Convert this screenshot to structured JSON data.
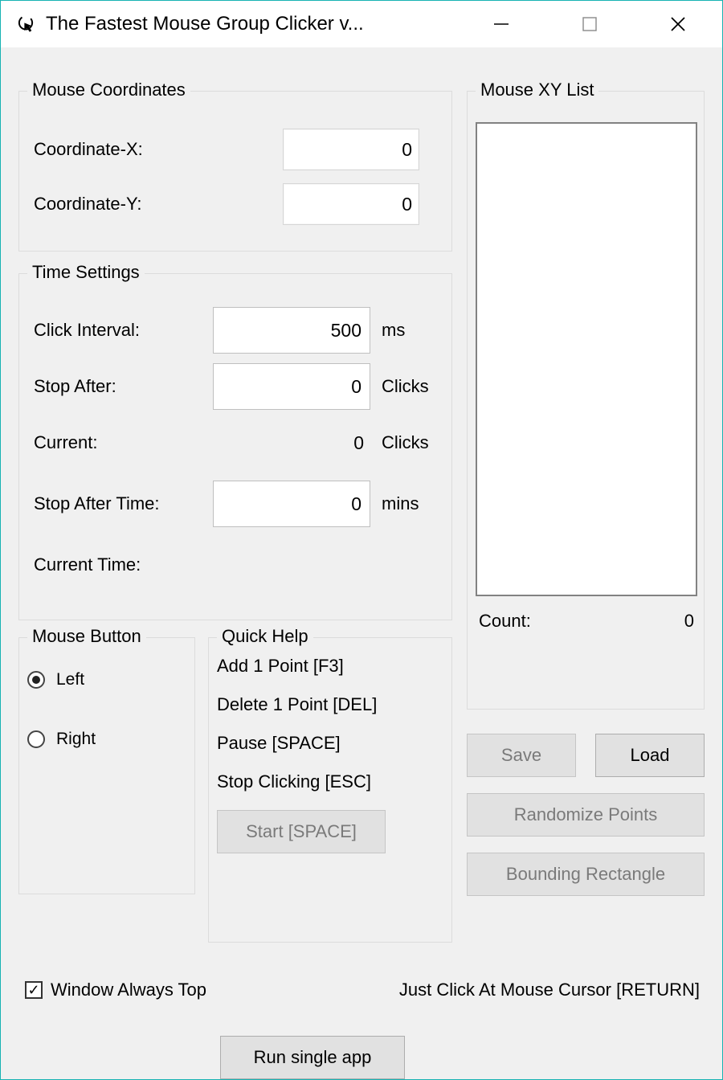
{
  "window": {
    "title": "The Fastest Mouse Group Clicker v..."
  },
  "coords": {
    "legend": "Mouse Coordinates",
    "x_label": "Coordinate-X:",
    "y_label": "Coordinate-Y:",
    "x_value": "0",
    "y_value": "0"
  },
  "time": {
    "legend": "Time Settings",
    "click_interval_label": "Click Interval:",
    "click_interval_value": "500",
    "click_interval_unit": "ms",
    "stop_after_label": "Stop After:",
    "stop_after_value": "0",
    "stop_after_unit": "Clicks",
    "current_label": "Current:",
    "current_value": "0",
    "current_unit": "Clicks",
    "stop_after_time_label": "Stop After Time:",
    "stop_after_time_value": "0",
    "stop_after_time_unit": "mins",
    "current_time_label": "Current Time:",
    "current_time_value": ""
  },
  "mouse_button": {
    "legend": "Mouse Button",
    "left_label": "Left",
    "right_label": "Right",
    "selected": "left"
  },
  "quick_help": {
    "legend": "Quick Help",
    "lines": [
      "Add 1 Point [F3]",
      "Delete 1 Point [DEL]",
      "Pause [SPACE]",
      "Stop Clicking [ESC]"
    ],
    "start_button": "Start [SPACE]"
  },
  "xylist": {
    "legend": "Mouse XY List",
    "count_label": "Count:",
    "count_value": "0"
  },
  "buttons": {
    "save": "Save",
    "load": "Load",
    "randomize": "Randomize Points",
    "bounding": "Bounding Rectangle",
    "run_single": "Run single app"
  },
  "bottom": {
    "always_top_label": "Window Always Top",
    "always_top_checked": true,
    "just_click_label": "Just Click At Mouse Cursor [RETURN]"
  }
}
